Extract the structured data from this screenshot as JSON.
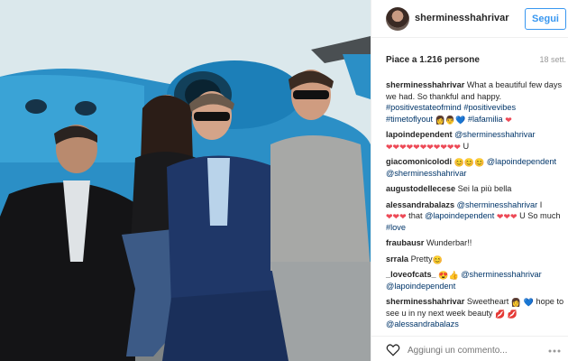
{
  "post": {
    "username": "sherminesshahrivar",
    "follow_label": "Segui",
    "likes": "Piace a 1.216 persone",
    "time": "18 sett."
  },
  "comments": [
    {
      "author": "sherminesshahrivar",
      "parts": [
        {
          "t": "text",
          "v": " What a beautiful few days we had. So thankful and happy. "
        },
        {
          "t": "tag",
          "v": "#positivestateofmind"
        },
        {
          "t": "text",
          "v": " "
        },
        {
          "t": "tag",
          "v": "#positivevibes"
        },
        {
          "t": "text",
          "v": " "
        },
        {
          "t": "tag",
          "v": "#timetoflyout"
        },
        {
          "t": "text",
          "v": " "
        },
        {
          "t": "emoji",
          "v": "👩👨",
          "c": "person"
        },
        {
          "t": "emoji",
          "v": "💙",
          "c": "blue"
        },
        {
          "t": "text",
          "v": " "
        },
        {
          "t": "tag",
          "v": "#lafamilia"
        },
        {
          "t": "text",
          "v": " "
        },
        {
          "t": "emoji",
          "v": "❤",
          "c": "heart"
        }
      ]
    },
    {
      "author": "lapoindependent",
      "parts": [
        {
          "t": "text",
          "v": " "
        },
        {
          "t": "tag",
          "v": "@sherminesshahrivar"
        },
        {
          "t": "text",
          "v": " "
        },
        {
          "t": "emoji",
          "v": "❤❤❤❤❤❤❤❤❤❤❤",
          "c": "heart"
        },
        {
          "t": "text",
          "v": " U"
        }
      ]
    },
    {
      "author": "giacomonicolodi",
      "parts": [
        {
          "t": "text",
          "v": " "
        },
        {
          "t": "emoji",
          "v": "😊😊😊",
          "c": "smile"
        },
        {
          "t": "text",
          "v": " "
        },
        {
          "t": "tag",
          "v": "@lapoindependent"
        },
        {
          "t": "text",
          "v": " "
        },
        {
          "t": "tag",
          "v": "@sherminesshahrivar"
        }
      ]
    },
    {
      "author": "augustodellecese",
      "parts": [
        {
          "t": "text",
          "v": " Sei la più bella"
        }
      ]
    },
    {
      "author": "alessandrabalazs",
      "parts": [
        {
          "t": "text",
          "v": " "
        },
        {
          "t": "tag",
          "v": "@sherminesshahrivar"
        },
        {
          "t": "text",
          "v": " I "
        },
        {
          "t": "emoji",
          "v": "❤❤❤",
          "c": "heart"
        },
        {
          "t": "text",
          "v": " that "
        },
        {
          "t": "tag",
          "v": "@lapoindependent"
        },
        {
          "t": "text",
          "v": " "
        },
        {
          "t": "emoji",
          "v": "❤❤❤",
          "c": "heart"
        },
        {
          "t": "text",
          "v": " U So much "
        },
        {
          "t": "tag",
          "v": "#love"
        }
      ]
    },
    {
      "author": "fraubausr",
      "parts": [
        {
          "t": "text",
          "v": " Wunderbar!!"
        }
      ]
    },
    {
      "author": "srrala",
      "parts": [
        {
          "t": "text",
          "v": " Pretty"
        },
        {
          "t": "emoji",
          "v": "😊",
          "c": "smile"
        }
      ]
    },
    {
      "author": "_loveofcats_",
      "parts": [
        {
          "t": "text",
          "v": " "
        },
        {
          "t": "emoji",
          "v": "😍👍",
          "c": "smile"
        },
        {
          "t": "text",
          "v": " "
        },
        {
          "t": "tag",
          "v": "@sherminesshahrivar"
        },
        {
          "t": "text",
          "v": " "
        },
        {
          "t": "tag",
          "v": "@lapoindependent"
        }
      ]
    },
    {
      "author": "sherminesshahrivar",
      "parts": [
        {
          "t": "text",
          "v": " Sweetheart "
        },
        {
          "t": "emoji",
          "v": "👩",
          "c": "person"
        },
        {
          "t": "text",
          "v": " "
        },
        {
          "t": "emoji",
          "v": "💙",
          "c": "blue"
        },
        {
          "t": "text",
          "v": " hope to see u in ny next week beauty "
        },
        {
          "t": "emoji",
          "v": "💋",
          "c": "lips"
        },
        {
          "t": "text",
          "v": " "
        },
        {
          "t": "emoji",
          "v": "💋",
          "c": "lips"
        },
        {
          "t": "text",
          "v": " "
        },
        {
          "t": "tag",
          "v": "@alessandrabalazs"
        }
      ]
    }
  ],
  "footer": {
    "comment_placeholder": "Aggiungi un commento...",
    "like_icon": "heart-outline-icon",
    "more_icon": "more-options-icon"
  },
  "colors": {
    "link": "#003569",
    "follow": "#3897f0",
    "muted": "#999999",
    "heart": "#ed4956"
  }
}
